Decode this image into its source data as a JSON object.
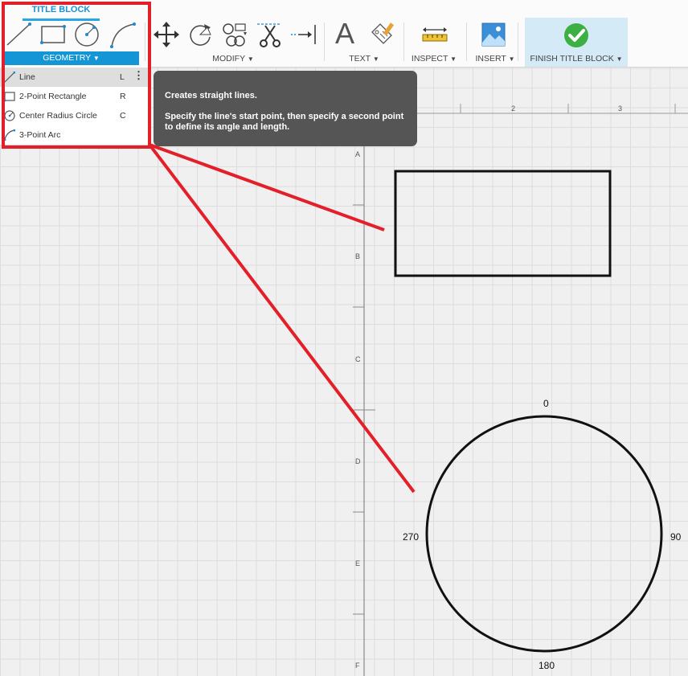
{
  "toolbar": {
    "tab_label": "TITLE BLOCK",
    "geometry_label": "GEOMETRY",
    "modify_label": "MODIFY",
    "text_label": "TEXT",
    "inspect_label": "INSPECT",
    "insert_label": "INSERT",
    "finish_label": "FINISH TITLE BLOCK",
    "text_icon_glyph": "A",
    "caret": "▼",
    "icons": [
      "line-icon",
      "rectangle-icon",
      "circle-icon",
      "arc-icon",
      "move-icon",
      "rotate-icon",
      "align-icon",
      "trim-icon",
      "extend-icon",
      "text-icon",
      "attribute-icon",
      "measure-icon",
      "insert-image-icon",
      "finish-check-icon"
    ]
  },
  "dropdown": {
    "items": [
      {
        "label": "Line",
        "shortcut": "L",
        "icon": "line-icon"
      },
      {
        "label": "2-Point Rectangle",
        "shortcut": "R",
        "icon": "rectangle-icon"
      },
      {
        "label": "Center Radius Circle",
        "shortcut": "C",
        "icon": "circle-icon"
      },
      {
        "label": "3-Point Arc",
        "shortcut": "",
        "icon": "arc-icon"
      }
    ],
    "more_glyph": "⋮"
  },
  "tooltip": {
    "title": "Creates straight lines.",
    "body": "Specify the line's start point, then specify a second point to define its angle and length."
  },
  "ruler": {
    "top_labels": [
      "2",
      "3"
    ],
    "left_labels": [
      "A",
      "B",
      "C",
      "D",
      "E",
      "F"
    ]
  },
  "circle_labels": {
    "top": "0",
    "right": "90",
    "bottom": "180",
    "left": "270"
  },
  "colors": {
    "accent": "#1495d6",
    "annotation_red": "#e3202a",
    "finish_green": "#3cb043"
  }
}
